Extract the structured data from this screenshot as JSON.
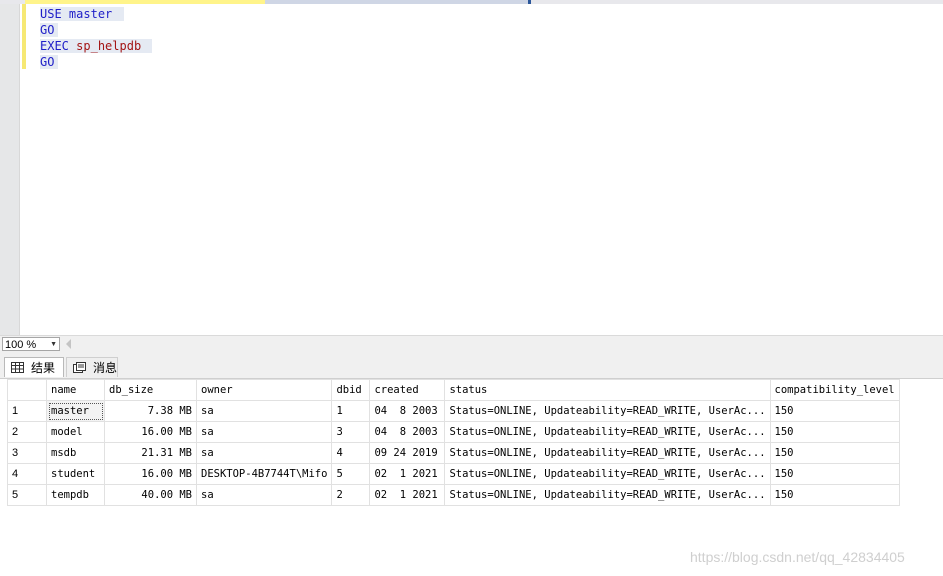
{
  "editor": {
    "lines": [
      {
        "kw": "USE",
        "rest": "master"
      },
      {
        "kw": "GO",
        "rest": ""
      },
      {
        "kw": "EXEC",
        "rest": "sp_helpdb"
      },
      {
        "kw": "GO",
        "rest": ""
      }
    ]
  },
  "zoom": {
    "value": "100 %"
  },
  "results_tabs": {
    "results": "结果",
    "messages": "消息"
  },
  "grid": {
    "columns": [
      "name",
      "db_size",
      "owner",
      "dbid",
      "created",
      "status",
      "compatibility_level"
    ],
    "rows": [
      {
        "num": "1",
        "name": "master",
        "db_size": "7.38 MB",
        "owner": "sa",
        "dbid": "1",
        "created": "04  8 2003",
        "status": "Status=ONLINE, Updateability=READ_WRITE, UserAc...",
        "compat": "150"
      },
      {
        "num": "2",
        "name": "model",
        "db_size": "16.00 MB",
        "owner": "sa",
        "dbid": "3",
        "created": "04  8 2003",
        "status": "Status=ONLINE, Updateability=READ_WRITE, UserAc...",
        "compat": "150"
      },
      {
        "num": "3",
        "name": "msdb",
        "db_size": "21.31 MB",
        "owner": "sa",
        "dbid": "4",
        "created": "09 24 2019",
        "status": "Status=ONLINE, Updateability=READ_WRITE, UserAc...",
        "compat": "150"
      },
      {
        "num": "4",
        "name": "student",
        "db_size": "16.00 MB",
        "owner": "DESKTOP-4B7744T\\Mifo",
        "dbid": "5",
        "created": "02  1 2021",
        "status": "Status=ONLINE, Updateability=READ_WRITE, UserAc...",
        "compat": "150"
      },
      {
        "num": "5",
        "name": "tempdb",
        "db_size": "40.00 MB",
        "owner": "sa",
        "dbid": "2",
        "created": "02  1 2021",
        "status": "Status=ONLINE, Updateability=READ_WRITE, UserAc...",
        "compat": "150"
      }
    ]
  },
  "watermark": "https://blog.csdn.net/qq_42834405"
}
